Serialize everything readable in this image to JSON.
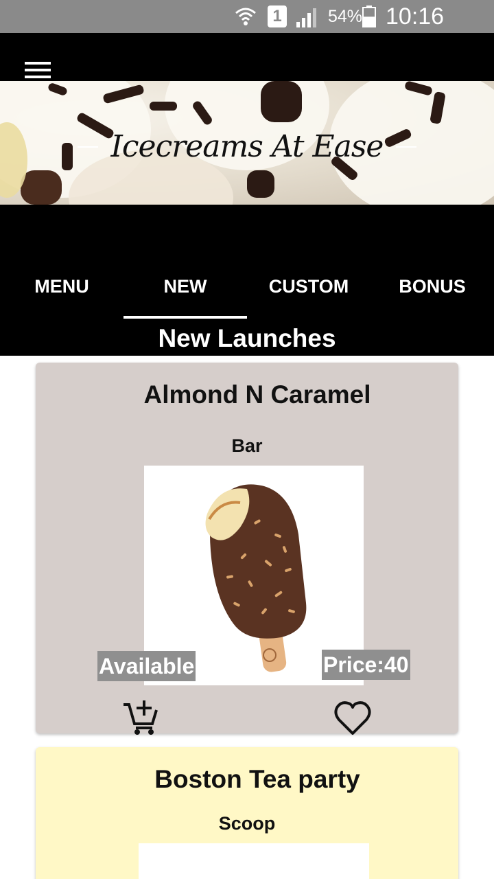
{
  "status_bar": {
    "sim_slot": "1",
    "battery_percent": "54%",
    "battery_level": 0.54,
    "time": "10:16 p.m."
  },
  "header": {
    "app_title": "Icecreams At Ease"
  },
  "tabs": [
    {
      "label": "MENU",
      "active": false
    },
    {
      "label": "NEW",
      "active": true
    },
    {
      "label": "CUSTOM",
      "active": false
    },
    {
      "label": "BONUS",
      "active": false
    }
  ],
  "section": {
    "title": "New Launches"
  },
  "products": [
    {
      "name": "Almond N Caramel",
      "type": "Bar",
      "availability": "Available",
      "price_label": "Price:40",
      "background": "#d6cecb"
    },
    {
      "name": "Boston Tea party",
      "type": "Scoop",
      "background": "#fff8c6"
    }
  ]
}
